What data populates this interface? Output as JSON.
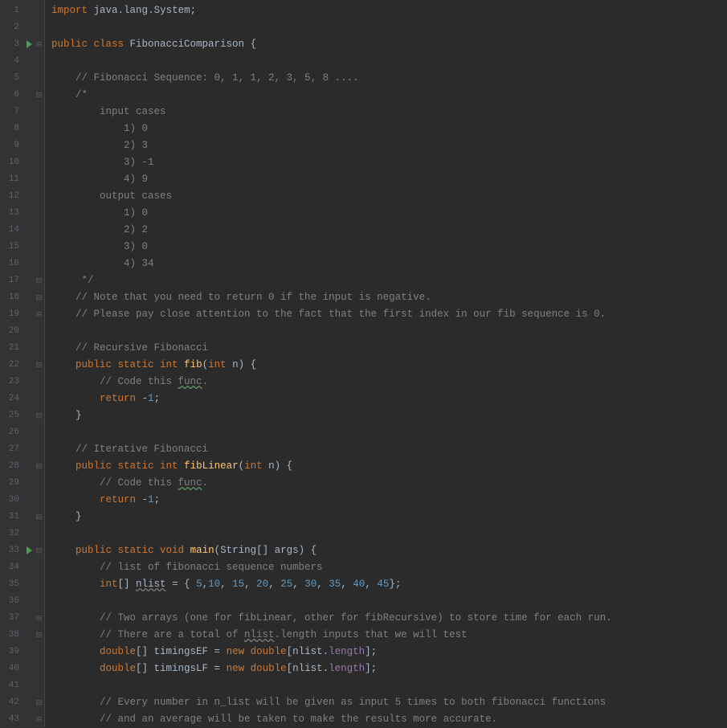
{
  "lines": [
    {
      "n": 1,
      "run": false,
      "fold": "",
      "tokens": [
        [
          "kw",
          "import "
        ],
        [
          "pkg",
          "java"
        ],
        [
          "punct",
          "."
        ],
        [
          "pkg",
          "lang"
        ],
        [
          "punct",
          "."
        ],
        [
          "pkg",
          "System"
        ],
        [
          "op",
          ";"
        ]
      ]
    },
    {
      "n": 2,
      "run": false,
      "fold": "",
      "tokens": []
    },
    {
      "n": 3,
      "run": true,
      "fold": "open",
      "tokens": [
        [
          "kw",
          "public "
        ],
        [
          "kw",
          "class "
        ],
        [
          "cls",
          "FibonacciComparison"
        ],
        [
          "punct",
          " {"
        ]
      ]
    },
    {
      "n": 4,
      "run": false,
      "fold": "",
      "tokens": []
    },
    {
      "n": 5,
      "run": false,
      "fold": "",
      "tokens": [
        [
          "",
          "    "
        ],
        [
          "comment",
          "// Fibonacci Sequence: 0, 1, 1, 2, 3, 5, 8 ...."
        ]
      ]
    },
    {
      "n": 6,
      "run": false,
      "fold": "open",
      "tokens": [
        [
          "",
          "    "
        ],
        [
          "comment",
          "/*"
        ]
      ]
    },
    {
      "n": 7,
      "run": false,
      "fold": "",
      "tokens": [
        [
          "comment",
          "        input cases"
        ]
      ]
    },
    {
      "n": 8,
      "run": false,
      "fold": "",
      "tokens": [
        [
          "comment",
          "            1) 0"
        ]
      ]
    },
    {
      "n": 9,
      "run": false,
      "fold": "",
      "tokens": [
        [
          "comment",
          "            2) 3"
        ]
      ]
    },
    {
      "n": 10,
      "run": false,
      "fold": "",
      "tokens": [
        [
          "comment",
          "            3) -1"
        ]
      ]
    },
    {
      "n": 11,
      "run": false,
      "fold": "",
      "tokens": [
        [
          "comment",
          "            4) 9"
        ]
      ]
    },
    {
      "n": 12,
      "run": false,
      "fold": "",
      "tokens": [
        [
          "comment",
          "        output cases"
        ]
      ]
    },
    {
      "n": 13,
      "run": false,
      "fold": "",
      "tokens": [
        [
          "comment",
          "            1) 0"
        ]
      ]
    },
    {
      "n": 14,
      "run": false,
      "fold": "",
      "tokens": [
        [
          "comment",
          "            2) 2"
        ]
      ]
    },
    {
      "n": 15,
      "run": false,
      "fold": "",
      "tokens": [
        [
          "comment",
          "            3) 0"
        ]
      ]
    },
    {
      "n": 16,
      "run": false,
      "fold": "",
      "tokens": [
        [
          "comment",
          "            4) 34"
        ]
      ]
    },
    {
      "n": 17,
      "run": false,
      "fold": "close",
      "tokens": [
        [
          "comment",
          "     */"
        ]
      ]
    },
    {
      "n": 18,
      "run": false,
      "fold": "open",
      "tokens": [
        [
          "",
          "    "
        ],
        [
          "comment",
          "// Note that you need to return 0 if the input is negative."
        ]
      ]
    },
    {
      "n": 19,
      "run": false,
      "fold": "close",
      "tokens": [
        [
          "",
          "    "
        ],
        [
          "comment",
          "// Please pay close attention to the fact that the first index in our fib sequence is 0."
        ]
      ]
    },
    {
      "n": 20,
      "run": false,
      "fold": "",
      "tokens": []
    },
    {
      "n": 21,
      "run": false,
      "fold": "",
      "tokens": [
        [
          "",
          "    "
        ],
        [
          "comment",
          "// Recursive Fibonacci"
        ]
      ]
    },
    {
      "n": 22,
      "run": false,
      "fold": "open",
      "tokens": [
        [
          "",
          "    "
        ],
        [
          "kw",
          "public "
        ],
        [
          "kw",
          "static "
        ],
        [
          "kw",
          "int "
        ],
        [
          "fn",
          "fib"
        ],
        [
          "punct",
          "("
        ],
        [
          "kw",
          "int "
        ],
        [
          "param",
          "n"
        ],
        [
          "punct",
          ")"
        ],
        [
          "punct",
          " {"
        ]
      ]
    },
    {
      "n": 23,
      "run": false,
      "fold": "",
      "tokens": [
        [
          "",
          "        "
        ],
        [
          "comment",
          "// Code this "
        ],
        [
          "comment typo",
          "func"
        ],
        [
          "comment",
          "."
        ]
      ]
    },
    {
      "n": 24,
      "run": false,
      "fold": "",
      "tokens": [
        [
          "",
          "        "
        ],
        [
          "kw",
          "return "
        ],
        [
          "punct",
          "-"
        ],
        [
          "num",
          "1"
        ],
        [
          "op",
          ";"
        ]
      ]
    },
    {
      "n": 25,
      "run": false,
      "fold": "close",
      "tokens": [
        [
          "",
          "    "
        ],
        [
          "punct",
          "}"
        ]
      ]
    },
    {
      "n": 26,
      "run": false,
      "fold": "",
      "tokens": []
    },
    {
      "n": 27,
      "run": false,
      "fold": "",
      "tokens": [
        [
          "",
          "    "
        ],
        [
          "comment",
          "// Iterative Fibonacci"
        ]
      ]
    },
    {
      "n": 28,
      "run": false,
      "fold": "open",
      "tokens": [
        [
          "",
          "    "
        ],
        [
          "kw",
          "public "
        ],
        [
          "kw",
          "static "
        ],
        [
          "kw",
          "int "
        ],
        [
          "fn",
          "fibLinear"
        ],
        [
          "punct",
          "("
        ],
        [
          "kw",
          "int "
        ],
        [
          "param",
          "n"
        ],
        [
          "punct",
          ")"
        ],
        [
          "punct",
          " {"
        ]
      ]
    },
    {
      "n": 29,
      "run": false,
      "fold": "",
      "tokens": [
        [
          "",
          "        "
        ],
        [
          "comment",
          "// Code this "
        ],
        [
          "comment typo",
          "func"
        ],
        [
          "comment",
          "."
        ]
      ]
    },
    {
      "n": 30,
      "run": false,
      "fold": "",
      "tokens": [
        [
          "",
          "        "
        ],
        [
          "kw",
          "return "
        ],
        [
          "punct",
          "-"
        ],
        [
          "num",
          "1"
        ],
        [
          "op",
          ";"
        ]
      ]
    },
    {
      "n": 31,
      "run": false,
      "fold": "close",
      "tokens": [
        [
          "",
          "    "
        ],
        [
          "punct",
          "}"
        ]
      ]
    },
    {
      "n": 32,
      "run": false,
      "fold": "",
      "tokens": []
    },
    {
      "n": 33,
      "run": true,
      "fold": "open",
      "tokens": [
        [
          "",
          "    "
        ],
        [
          "kw",
          "public "
        ],
        [
          "kw",
          "static "
        ],
        [
          "kw",
          "void "
        ],
        [
          "fn",
          "main"
        ],
        [
          "punct",
          "("
        ],
        [
          "cls",
          "String"
        ],
        [
          "punct",
          "[] "
        ],
        [
          "param",
          "args"
        ],
        [
          "punct",
          ")"
        ],
        [
          "punct",
          " {"
        ]
      ]
    },
    {
      "n": 34,
      "run": false,
      "fold": "",
      "tokens": [
        [
          "",
          "        "
        ],
        [
          "comment",
          "// list of fibonacci sequence numbers"
        ]
      ]
    },
    {
      "n": 35,
      "run": false,
      "fold": "",
      "tokens": [
        [
          "",
          "        "
        ],
        [
          "kw",
          "int"
        ],
        [
          "punct",
          "[] "
        ],
        [
          "warn",
          "nlist"
        ],
        [
          "punct",
          " = { "
        ],
        [
          "num",
          "5"
        ],
        [
          "punct",
          ","
        ],
        [
          "num",
          "10"
        ],
        [
          "punct",
          ", "
        ],
        [
          "num",
          "15"
        ],
        [
          "punct",
          ", "
        ],
        [
          "num",
          "20"
        ],
        [
          "punct",
          ", "
        ],
        [
          "num",
          "25"
        ],
        [
          "punct",
          ", "
        ],
        [
          "num",
          "30"
        ],
        [
          "punct",
          ", "
        ],
        [
          "num",
          "35"
        ],
        [
          "punct",
          ", "
        ],
        [
          "num",
          "40"
        ],
        [
          "punct",
          ", "
        ],
        [
          "num",
          "45"
        ],
        [
          "punct",
          "}"
        ],
        [
          "op",
          ";"
        ]
      ]
    },
    {
      "n": 36,
      "run": false,
      "fold": "",
      "tokens": []
    },
    {
      "n": 37,
      "run": false,
      "fold": "open",
      "tokens": [
        [
          "",
          "        "
        ],
        [
          "comment",
          "// Two arrays (one for fibLinear, other for fibRecursive) to store time for each run."
        ]
      ]
    },
    {
      "n": 38,
      "run": false,
      "fold": "close",
      "tokens": [
        [
          "",
          "        "
        ],
        [
          "comment",
          "// There are a total of "
        ],
        [
          "comment warn",
          "nlist"
        ],
        [
          "comment",
          ".length inputs that we will test"
        ]
      ]
    },
    {
      "n": 39,
      "run": false,
      "fold": "",
      "tokens": [
        [
          "",
          "        "
        ],
        [
          "kw",
          "double"
        ],
        [
          "punct",
          "[] "
        ],
        [
          "",
          "timingsEF = "
        ],
        [
          "kw",
          "new "
        ],
        [
          "kw",
          "double"
        ],
        [
          "punct",
          "["
        ],
        [
          "",
          "nlist"
        ],
        [
          "punct",
          "."
        ],
        [
          "field",
          "length"
        ],
        [
          "punct",
          "]"
        ],
        [
          "op",
          ";"
        ]
      ]
    },
    {
      "n": 40,
      "run": false,
      "fold": "",
      "tokens": [
        [
          "",
          "        "
        ],
        [
          "kw",
          "double"
        ],
        [
          "punct",
          "[] "
        ],
        [
          "",
          "timingsLF = "
        ],
        [
          "kw",
          "new "
        ],
        [
          "kw",
          "double"
        ],
        [
          "punct",
          "["
        ],
        [
          "",
          "nlist"
        ],
        [
          "punct",
          "."
        ],
        [
          "field",
          "length"
        ],
        [
          "punct",
          "]"
        ],
        [
          "op",
          ";"
        ]
      ]
    },
    {
      "n": 41,
      "run": false,
      "fold": "",
      "tokens": []
    },
    {
      "n": 42,
      "run": false,
      "fold": "open",
      "tokens": [
        [
          "",
          "        "
        ],
        [
          "comment",
          "// Every number in n_list will be given as input 5 times to both fibonacci functions"
        ]
      ]
    },
    {
      "n": 43,
      "run": false,
      "fold": "close",
      "tokens": [
        [
          "",
          "        "
        ],
        [
          "comment",
          "// and an average will be taken to make the results more accurate."
        ]
      ]
    }
  ]
}
